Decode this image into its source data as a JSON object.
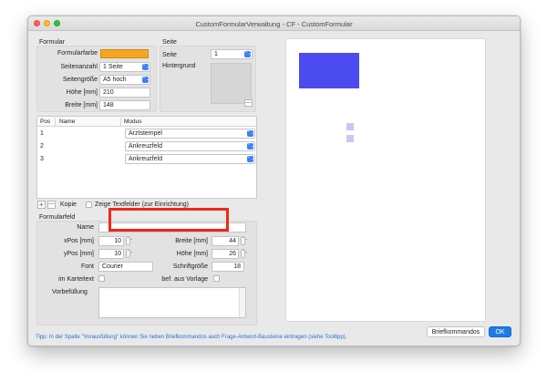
{
  "window": {
    "title": "CustomFormularVerwaltung - CF - CustomFormular"
  },
  "formular": {
    "group_label": "Formular",
    "farbe_label": "Formularfarbe",
    "farbe_color": "#f6a623",
    "seitenanzahl_label": "Seitenanzahl",
    "seitenanzahl_value": "1 Seite",
    "seitengroesse_label": "Seitengröße",
    "seitengroesse_value": "A5 hoch",
    "hoehe_label": "Höhe [mm]",
    "hoehe_value": "210",
    "breite_label": "Breite [mm]",
    "breite_value": "148"
  },
  "seite": {
    "group_label": "Seite",
    "seite_label": "Seite",
    "seite_value": "1",
    "hintergrund_label": "Hintergrund",
    "remove_label": "—"
  },
  "table": {
    "columns": [
      "Pos",
      "Name",
      "Modus"
    ],
    "rows": [
      {
        "pos": "1",
        "name": "",
        "modus": "Arztstempel"
      },
      {
        "pos": "2",
        "name": "",
        "modus": "Ankreuzfeld"
      },
      {
        "pos": "3",
        "name": "",
        "modus": "Ankreuzfeld"
      }
    ]
  },
  "toolbar": {
    "add_label": "+",
    "remove_label": "—",
    "kopie_label": "Kopie",
    "zeige_textfelder_label": "Zeige Textfelder (zur Einrichtung)"
  },
  "formularfeld": {
    "group_label": "Formularfeld",
    "name_label": "Name",
    "name_value": "",
    "xpos_label": "xPos [mm]",
    "xpos_value": "10",
    "ypos_label": "yPos [mm]",
    "ypos_value": "10",
    "breite_label": "Breite [mm]",
    "breite_value": "44",
    "hoehe_label": "Höhe [mm]",
    "hoehe_value": "26",
    "font_label": "Font",
    "font_value": "Courier",
    "schriftgroesse_label": "Schriftgröße",
    "schriftgroesse_value": "18",
    "im_karteitext_label": "im Karteitext",
    "bef_aus_vorlage_label": "bef. aus Vorlage",
    "vorbefuellung_label": "Vorbefüllung",
    "vorbefuellung_value": ""
  },
  "tip": "Tipp: In der Spalte \"Vorausfüllung\" können Sie neben Briefkommandos auch Frage-Antwort-Bausteine eintragen (siehe Tooltipp).",
  "buttons": {
    "briefkommandos": "Briefkommandos",
    "ok": "OK"
  },
  "preview_colors": {
    "main_rect": "#4b4bf0",
    "small_rect": "#c7c7f7"
  },
  "stepper_glyph": "⌃⌄",
  "popup_glyph": "⌃⌄"
}
